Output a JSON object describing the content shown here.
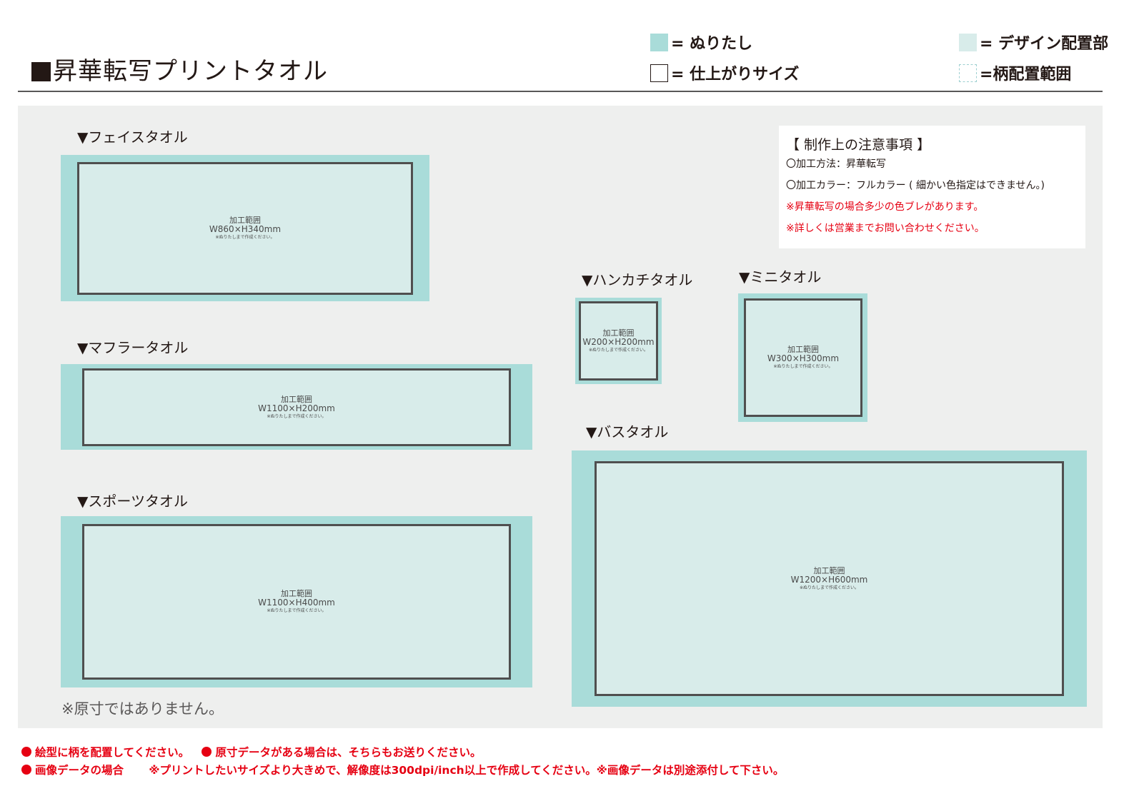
{
  "header": {
    "title": "昇華転写プリントタオル"
  },
  "legend": {
    "bleed": "= ぬりたし",
    "finish": "= 仕上がりサイズ",
    "design": "= デザイン配置部",
    "pattern": "=柄配置範囲"
  },
  "colors": {
    "bleed": "#a9dcd9",
    "design_area": "#d8ecea",
    "panel_bg": "#eeefee",
    "warning_red": "#e60012",
    "trim_line": "#4f4f4f"
  },
  "towels": [
    {
      "label": "▼フェイスタオル",
      "area_label": "加工範囲",
      "size": "W860×H340mm",
      "note": "※ぬりたしまで作成ください。"
    },
    {
      "label": "▼マフラータオル",
      "area_label": "加工範囲",
      "size": "W1100×H200mm",
      "note": "※ぬりたしまで作成ください。"
    },
    {
      "label": "▼スポーツタオル",
      "area_label": "加工範囲",
      "size": "W1100×H400mm",
      "note": "※ぬりたしまで作成ください。"
    },
    {
      "label": "▼ハンカチタオル",
      "area_label": "加工範囲",
      "size": "W200×H200mm",
      "note": "※ぬりたしまで作成ください。"
    },
    {
      "label": "▼ミニタオル",
      "area_label": "加工範囲",
      "size": "W300×H300mm",
      "note": "※ぬりたしまで作成ください。"
    },
    {
      "label": "▼バスタオル",
      "area_label": "加工範囲",
      "size": "W1200×H600mm",
      "note": "※ぬりたしまで作成ください。"
    }
  ],
  "notes": {
    "title": "【 制作上の注意事項 】",
    "lines": [
      "〇加工方法：昇華転写",
      "〇加工カラー：フルカラー ( 細かい色指定はできません。)",
      "※昇華転写の場合多少の色ブレがあります。",
      "※詳しくは営業までお問い合わせください。"
    ]
  },
  "not_actual_size": "※原寸ではありません。",
  "footer": {
    "line1_a": "絵型に柄を配置してください。",
    "line1_b": "原寸データがある場合は、そちらもお送りください。",
    "line2_a": "画像データの場合",
    "line2_b": "※プリントしたいサイズより大きめで、解像度は300dpi/inch以上で作成してください。※画像データは別途添付して下さい。"
  }
}
